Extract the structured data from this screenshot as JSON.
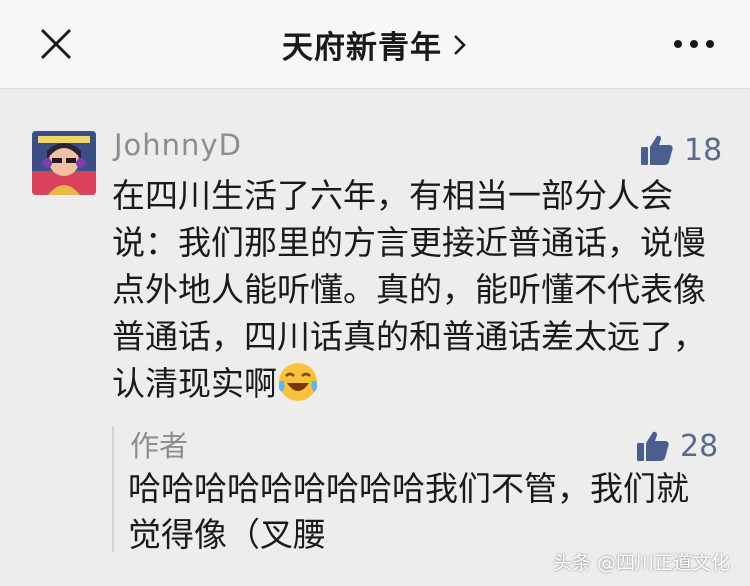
{
  "header": {
    "title": "天府新青年",
    "close_icon": "close-icon",
    "more_icon": "more-icon"
  },
  "comment": {
    "username": "JohnnyD",
    "likes": "18",
    "text": "在四川生活了六年，有相当一部分人会说：我们那里的方言更接近普通话，说慢点外地人能听懂。真的，能听懂不代表像普通话，四川话真的和普通话差太远了，认清现实啊",
    "emoji": "laughing-crying-emoji"
  },
  "reply": {
    "author": "作者",
    "likes": "28",
    "text": "哈哈哈哈哈哈哈哈哈我们不管，我们就觉得像（叉腰"
  },
  "watermark": "头条 @四川正道文化",
  "colors": {
    "header_bg": "#f7f7f7",
    "page_bg": "#ededed",
    "like_blue": "#4a5e8f",
    "muted_text": "#8d8d8d"
  }
}
